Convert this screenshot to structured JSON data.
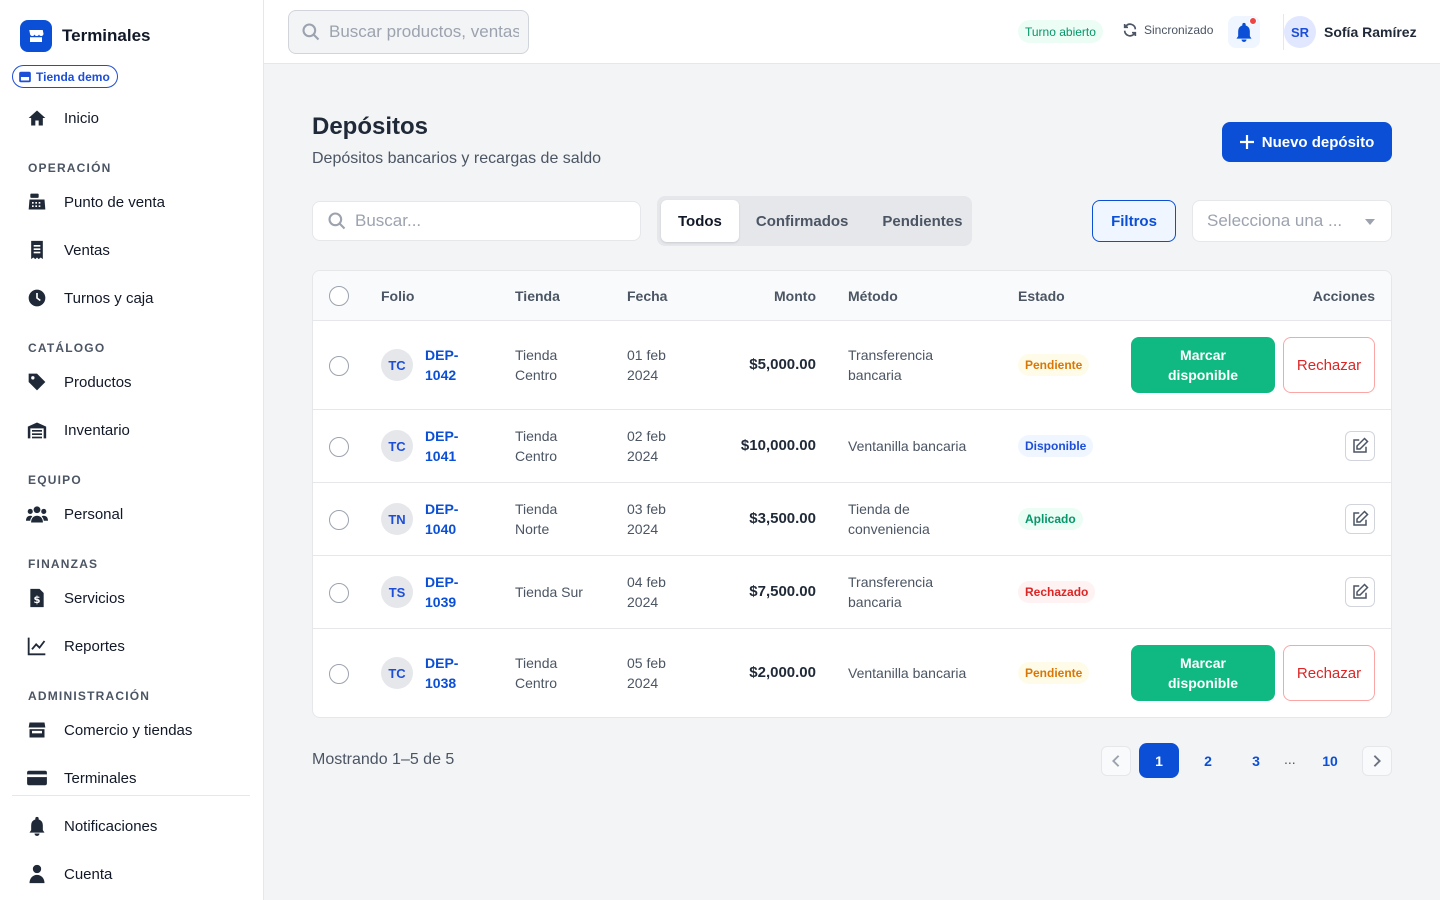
{
  "brand": {
    "name": "Terminales",
    "store_chip": "Tienda demo"
  },
  "sidebar": {
    "home": "Inicio",
    "sections": {
      "operation": "OPERACIÓN",
      "catalog": "CATÁLOGO",
      "team": "EQUIPO",
      "finance": "FINANZAS",
      "admin": "ADMINISTRACIÓN"
    },
    "items": {
      "pos": "Punto de venta",
      "sales": "Ventas",
      "shifts": "Turnos y caja",
      "products": "Productos",
      "inventory": "Inventario",
      "staff": "Personal",
      "services": "Servicios",
      "reports": "Reportes",
      "stores": "Comercio y tiendas",
      "terminals": "Terminales",
      "notifications": "Notificaciones",
      "account": "Cuenta"
    }
  },
  "topbar": {
    "search_placeholder": "Buscar productos, ventas...",
    "shift_status": "Turno abierto",
    "sync_status": "Sincronizado",
    "user_initials": "SR",
    "user_name": "Sofía Ramírez"
  },
  "page": {
    "title": "Depósitos",
    "subtitle": "Depósitos bancarios y recargas de saldo",
    "new_button": "Nuevo depósito",
    "search_placeholder": "Buscar...",
    "tabs": [
      "Todos",
      "Confirmados",
      "Pendientes"
    ],
    "active_tab": "Todos",
    "filters_button": "Filtros",
    "select_placeholder": "Selecciona una ..."
  },
  "table": {
    "columns": {
      "folio": "Folio",
      "store": "Tienda",
      "date": "Fecha",
      "amount": "Monto",
      "method": "Método",
      "status": "Estado",
      "actions": "Acciones"
    },
    "rows": [
      {
        "initials": "TC",
        "folio_a": "DEP-",
        "folio_b": "1042",
        "store_a": "Tienda",
        "store_b": "Centro",
        "date_a": "01 feb",
        "date_b": "2024",
        "amount": "$5,000.00",
        "method_a": "Transferencia",
        "method_b": "bancaria",
        "status": "Pendiente"
      },
      {
        "initials": "TC",
        "folio_a": "DEP-",
        "folio_b": "1041",
        "store_a": "Tienda",
        "store_b": "Centro",
        "date_a": "02 feb",
        "date_b": "2024",
        "amount": "$10,000.00",
        "method_a": "Ventanilla bancaria",
        "method_b": "",
        "status": "Disponible"
      },
      {
        "initials": "TN",
        "folio_a": "DEP-",
        "folio_b": "1040",
        "store_a": "Tienda",
        "store_b": "Norte",
        "date_a": "03 feb",
        "date_b": "2024",
        "amount": "$3,500.00",
        "method_a": "Tienda de",
        "method_b": "conveniencia",
        "status": "Aplicado"
      },
      {
        "initials": "TS",
        "folio_a": "DEP-",
        "folio_b": "1039",
        "store_a": "Tienda Sur",
        "store_b": "",
        "date_a": "04 feb",
        "date_b": "2024",
        "amount": "$7,500.00",
        "method_a": "Transferencia",
        "method_b": "bancaria",
        "status": "Rechazado"
      },
      {
        "initials": "TC",
        "folio_a": "DEP-",
        "folio_b": "1038",
        "store_a": "Tienda",
        "store_b": "Centro",
        "date_a": "05 feb",
        "date_b": "2024",
        "amount": "$2,000.00",
        "method_a": "Ventanilla bancaria",
        "method_b": "",
        "status": "Pendiente"
      }
    ],
    "action_mark_a": "Marcar",
    "action_mark_b": "disponible",
    "action_reject": "Rechazar"
  },
  "footer": {
    "showing": "Mostrando 1–5 de 5",
    "pages": [
      "1",
      "2",
      "3",
      "10"
    ],
    "ellipsis": "...",
    "current_page": "1"
  },
  "colors": {
    "primary": "#0a4fd6",
    "success": "#10b981",
    "danger": "#dc2626",
    "pending": "#d97706"
  }
}
